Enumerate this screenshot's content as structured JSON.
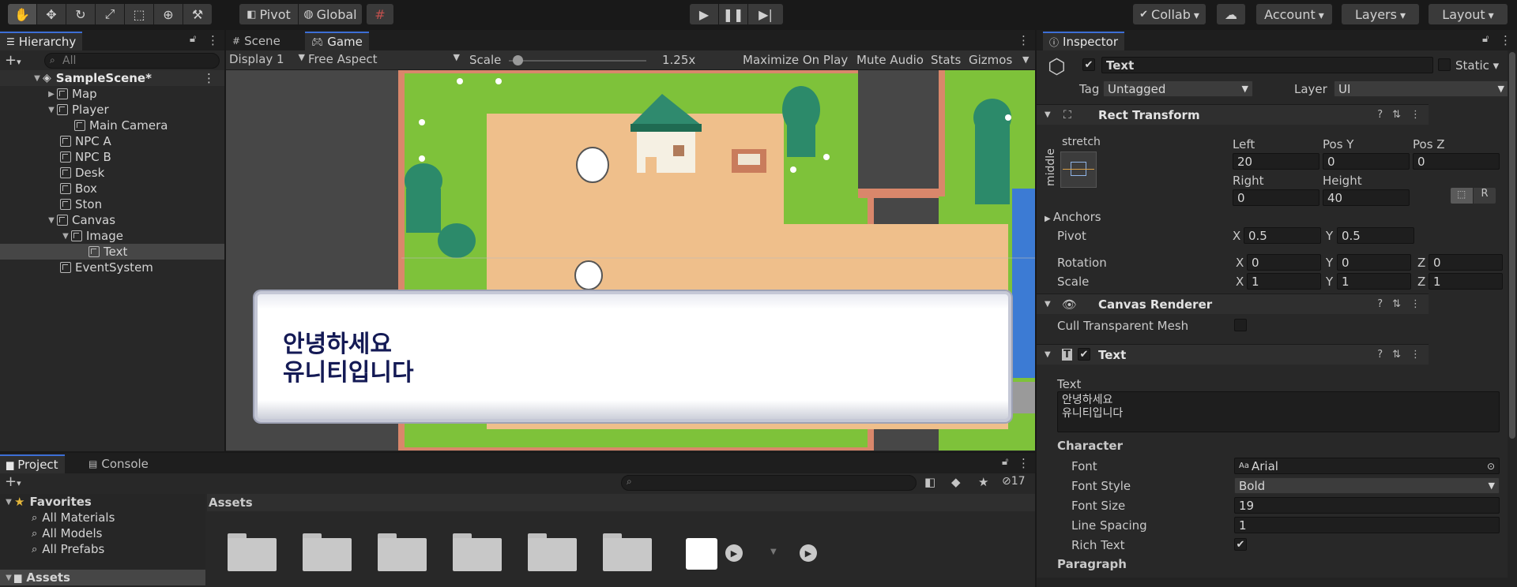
{
  "toolbar": {
    "pivot_label": "Pivot",
    "global_label": "Global",
    "collab_label": "Collab",
    "account_label": "Account",
    "layers_label": "Layers",
    "layout_label": "Layout"
  },
  "hierarchy": {
    "tab_label": "Hierarchy",
    "search_placeholder": "All",
    "scene_name": "SampleScene*",
    "items": [
      {
        "label": "Map"
      },
      {
        "label": "Player"
      },
      {
        "label": "Main Camera"
      },
      {
        "label": "NPC A"
      },
      {
        "label": "NPC B"
      },
      {
        "label": "Desk"
      },
      {
        "label": "Box"
      },
      {
        "label": "Ston"
      },
      {
        "label": "Canvas"
      },
      {
        "label": "Image"
      },
      {
        "label": "Text"
      },
      {
        "label": "EventSystem"
      }
    ]
  },
  "center": {
    "scene_tab": "Scene",
    "game_tab": "Game",
    "display": "Display 1",
    "aspect": "Free Aspect",
    "scale_label": "Scale",
    "scale_value": 1.25,
    "scale_text": "1.25x",
    "maximize": "Maximize On Play",
    "mute": "Mute Audio",
    "stats": "Stats",
    "gizmos": "Gizmos",
    "dialog_text": "안녕하세요\n유니티입니다"
  },
  "project": {
    "project_tab": "Project",
    "console_tab": "Console",
    "favorites": "Favorites",
    "fav_items": [
      "All Materials",
      "All Models",
      "All Prefabs"
    ],
    "assets_root": "Assets",
    "assets_header": "Assets",
    "hidden_count": "17"
  },
  "inspector": {
    "tab_label": "Inspector",
    "object_name": "Text",
    "static_label": "Static",
    "tag_label": "Tag",
    "tag_value": "Untagged",
    "layer_label": "Layer",
    "layer_value": "UI",
    "rect_transform": {
      "title": "Rect Transform",
      "stretch": "stretch",
      "middle": "middle",
      "left_label": "Left",
      "left": "20",
      "posy_label": "Pos Y",
      "posy": "0",
      "posz_label": "Pos Z",
      "posz": "0",
      "right_label": "Right",
      "right": "0",
      "height_label": "Height",
      "height": "40",
      "r_btn": "R",
      "anchors": "Anchors",
      "pivot_label": "Pivot",
      "pivot_x": "0.5",
      "pivot_y": "0.5",
      "rotation_label": "Rotation",
      "rot_x": "0",
      "rot_y": "0",
      "rot_z": "0",
      "scale_label": "Scale",
      "scale_x": "1",
      "scale_y": "1",
      "scale_z": "1",
      "x": "X",
      "y": "Y",
      "z": "Z"
    },
    "canvas_renderer": {
      "title": "Canvas Renderer",
      "cull_label": "Cull Transparent Mesh"
    },
    "text_component": {
      "title": "Text",
      "text_label": "Text",
      "text_value": "안녕하세요\n유니티입니다",
      "character": "Character",
      "font_label": "Font",
      "font_value": "Arial",
      "font_style_label": "Font Style",
      "font_style_value": "Bold",
      "font_size_label": "Font Size",
      "font_size_value": "19",
      "line_spacing_label": "Line Spacing",
      "line_spacing_value": "1",
      "rich_text_label": "Rich Text",
      "paragraph": "Paragraph"
    }
  }
}
